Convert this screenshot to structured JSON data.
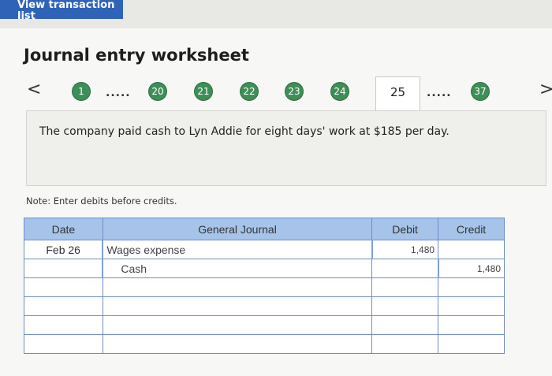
{
  "top_button": "View transaction list",
  "title": "Journal entry worksheet",
  "nav": {
    "prev": "<",
    "next": ">",
    "items": [
      {
        "label": "1",
        "type": "circle"
      },
      {
        "label": ".....",
        "type": "dots"
      },
      {
        "label": "20",
        "type": "circle"
      },
      {
        "label": "21",
        "type": "circle"
      },
      {
        "label": "22",
        "type": "circle"
      },
      {
        "label": "23",
        "type": "circle"
      },
      {
        "label": "24",
        "type": "circle"
      },
      {
        "label": "25",
        "type": "current"
      },
      {
        "label": ".....",
        "type": "dots"
      },
      {
        "label": "37",
        "type": "circle"
      }
    ]
  },
  "question": "The company paid cash to Lyn Addie for eight days' work at $185 per day.",
  "note": "Note: Enter debits before credits.",
  "journal": {
    "headers": {
      "date": "Date",
      "general_journal": "General Journal",
      "debit": "Debit",
      "credit": "Credit"
    },
    "rows": [
      {
        "date": "Feb 26",
        "account": "Wages expense",
        "debit": "1,480",
        "credit": ""
      },
      {
        "date": "",
        "account": "Cash",
        "debit": "",
        "credit": "1,480"
      },
      {
        "date": "",
        "account": "",
        "debit": "",
        "credit": ""
      },
      {
        "date": "",
        "account": "",
        "debit": "",
        "credit": ""
      },
      {
        "date": "",
        "account": "",
        "debit": "",
        "credit": ""
      },
      {
        "date": "",
        "account": "",
        "debit": "",
        "credit": ""
      }
    ]
  },
  "colors": {
    "accent": "#2e63b8",
    "nav_circle": "#3d8f57",
    "table_header": "#a6c4ea"
  }
}
